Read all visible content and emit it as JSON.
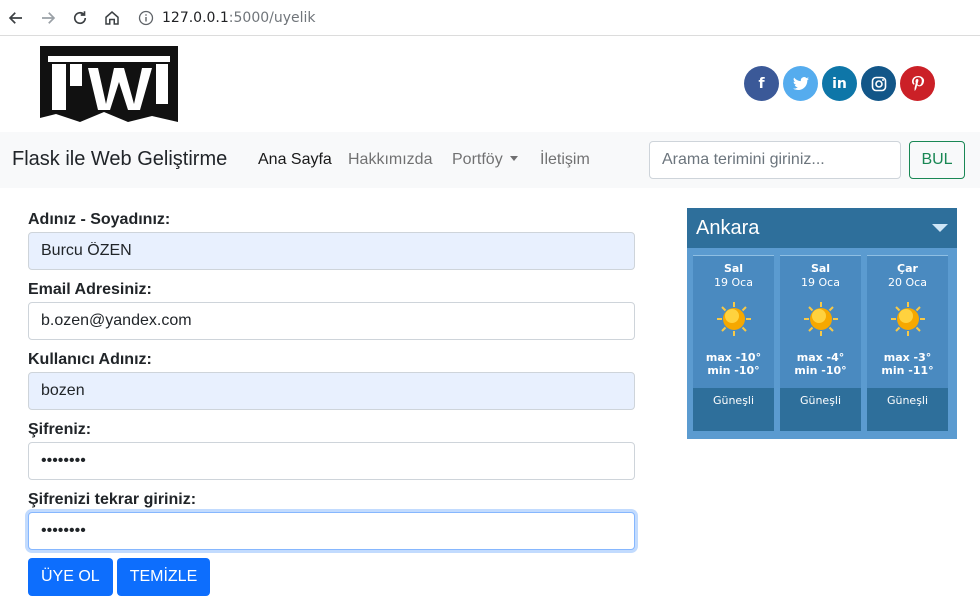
{
  "browser": {
    "url_host": "127.0.0.1",
    "url_path": ":5000/uyelik"
  },
  "header": {
    "social": [
      {
        "name": "facebook-icon",
        "glyph": "f",
        "color": "#3b5998"
      },
      {
        "name": "twitter-icon",
        "glyph": "t",
        "color": "#55acee"
      },
      {
        "name": "linkedin-icon",
        "glyph": "in",
        "color": "#0e76a8"
      },
      {
        "name": "instagram-icon",
        "glyph": "◎",
        "color": "#125688"
      },
      {
        "name": "pinterest-icon",
        "glyph": "p",
        "color": "#cb2027"
      }
    ]
  },
  "navbar": {
    "brand": "Flask ile Web Geliştirme",
    "items": [
      "Ana Sayfa",
      "Hakkımızda",
      "Portföy",
      "İletişim"
    ],
    "search_placeholder": "Arama terimini giriniz...",
    "search_button": "BUL",
    "accent": "#198754"
  },
  "form": {
    "name_label": "Adınız - Soyadınız:",
    "name_value": "Burcu ÖZEN",
    "email_label": "Email Adresiniz:",
    "email_value": "b.ozen@yandex.com",
    "username_label": "Kullanıcı Adınız:",
    "username_value": "bozen",
    "password_label": "Şifreniz:",
    "password_value": "••••••••",
    "password2_label": "Şifrenizi tekrar giriniz:",
    "password2_value": "••••••••",
    "submit": "ÜYE OL",
    "reset": "TEMİZLE",
    "button_color": "#0d6efd"
  },
  "weather": {
    "city": "Ankara",
    "days": [
      {
        "day": "Sal",
        "date": "19 Oca",
        "max": "max -10°",
        "min": "min -10°",
        "cond": "Güneşli"
      },
      {
        "day": "Sal",
        "date": "19 Oca",
        "max": "max -4°",
        "min": "min -10°",
        "cond": "Güneşli"
      },
      {
        "day": "Çar",
        "date": "20 Oca",
        "max": "max -3°",
        "min": "min -11°",
        "cond": "Güneşli"
      }
    ]
  }
}
